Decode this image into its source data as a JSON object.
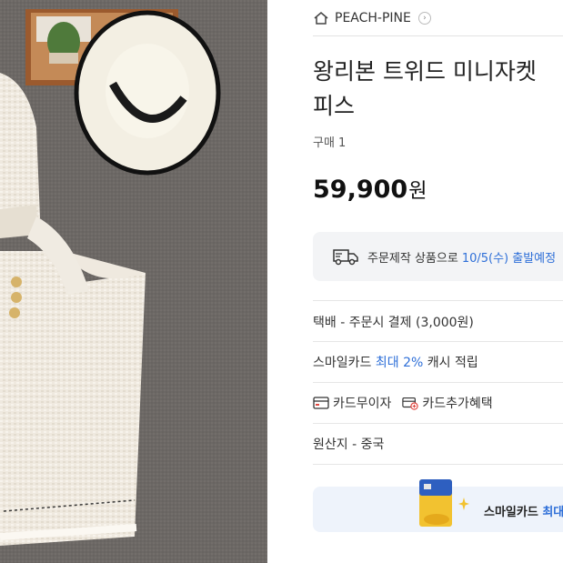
{
  "product_image": {
    "alt_icon": "product-photo"
  },
  "shop": {
    "name": "PEACH-PINE",
    "arrow": "›"
  },
  "product": {
    "title_line1": "왕리본 트위드 미니자켓",
    "title_line2": "피스",
    "purchase_count": "구매 1",
    "price": "59,900",
    "price_unit": "원"
  },
  "notice": {
    "text": "주문제작 상품으로",
    "highlight": "10/5(수) 출발예정"
  },
  "shipping": {
    "text": "택배 - 주문시 결제 (3,000원)"
  },
  "smile_card": {
    "prefix": "스마일카드",
    "highlight": "최대 2%",
    "suffix": "캐시 적립"
  },
  "card_benefits": {
    "interest_free": "카드무이자",
    "extra_benefit": "카드추가혜택"
  },
  "origin": {
    "text": "원산지 - 중국"
  },
  "banner": {
    "prefix": "스마일카드",
    "highlight": "최대"
  },
  "colors": {
    "accent_blue": "#2e6fd8",
    "notice_bg": "#f3f4f6",
    "banner_bg": "#eef3fb",
    "photo_bg": "#6e6a67"
  }
}
